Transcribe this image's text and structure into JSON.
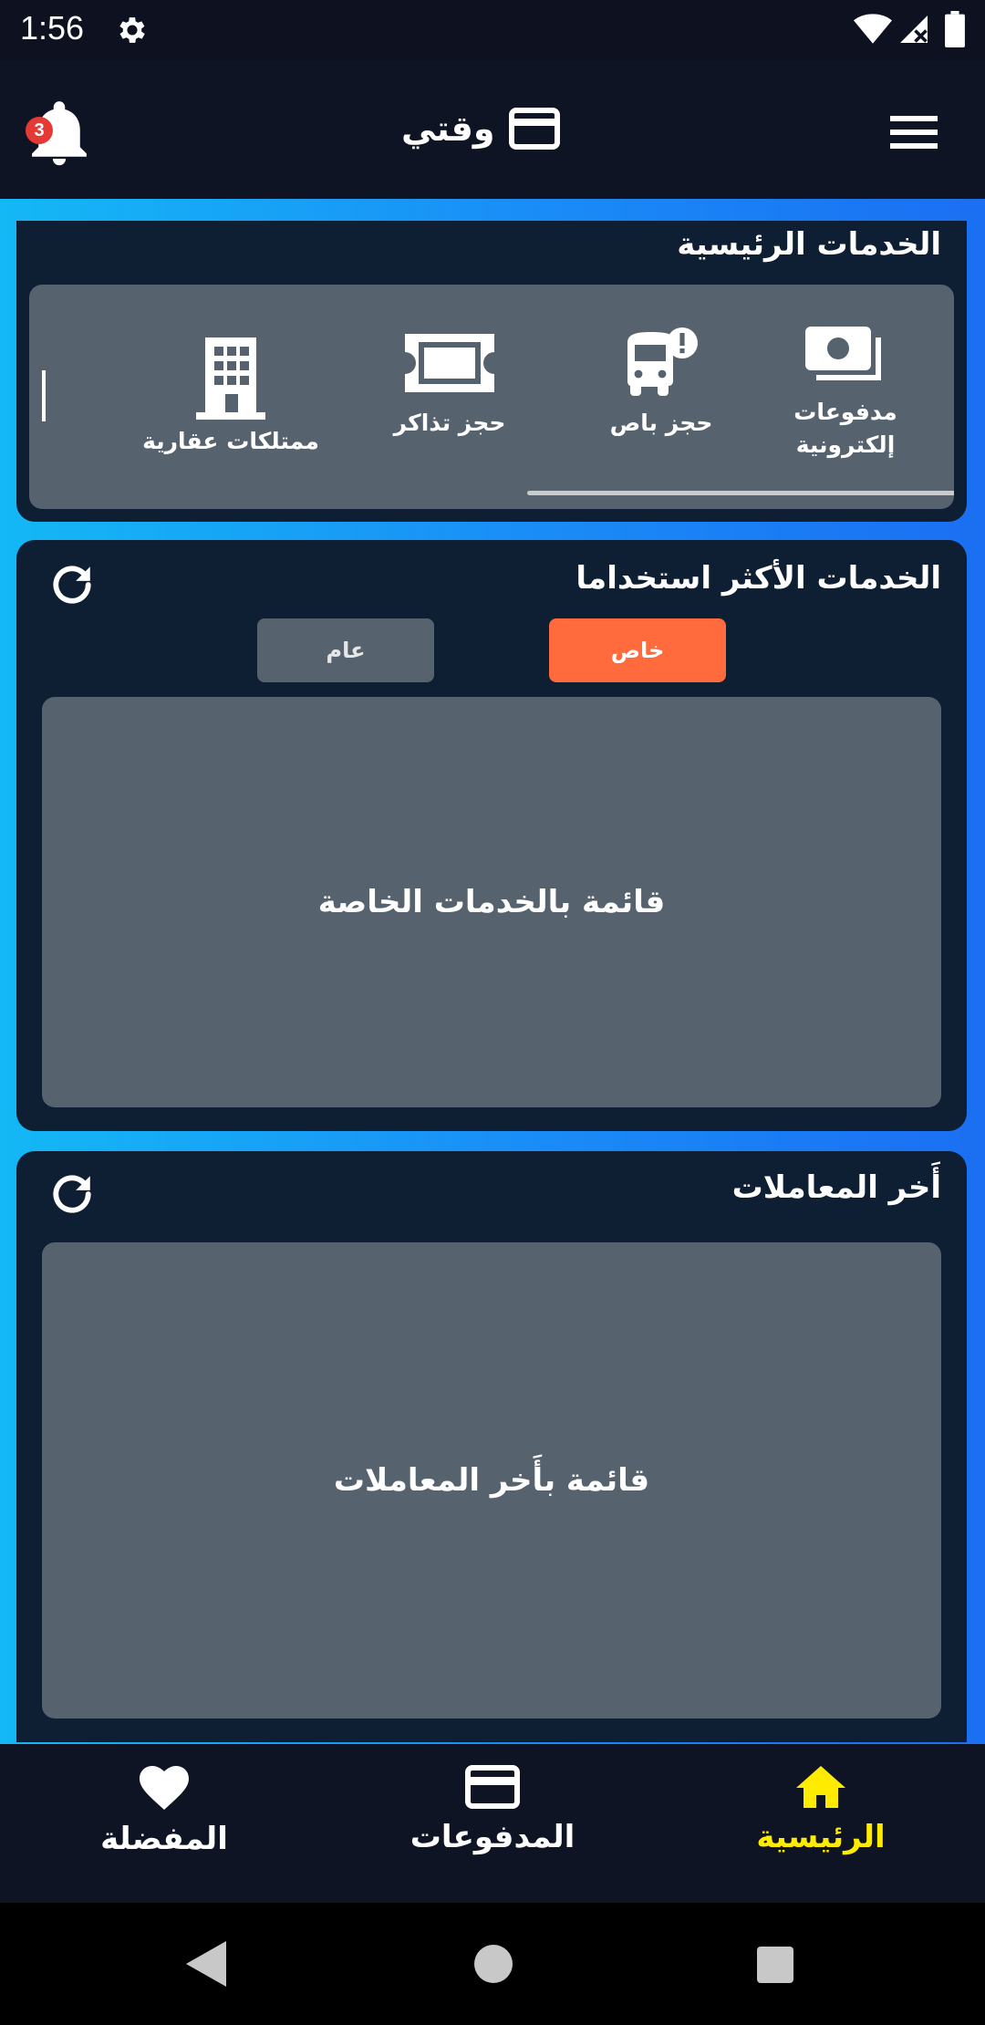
{
  "status_bar": {
    "time": "1:56"
  },
  "app_bar": {
    "title": "وقتي",
    "notification_count": "3"
  },
  "main_services": {
    "title": "الخدمات الرئيسية",
    "items": [
      {
        "label": "مدفوعات\nإلكترونية",
        "icon": "cash-icon"
      },
      {
        "label": "حجز باص",
        "icon": "bus-alert-icon"
      },
      {
        "label": "حجز تذاكر",
        "icon": "ticket-icon"
      },
      {
        "label": "ممتلكات عقارية",
        "icon": "building-icon"
      }
    ]
  },
  "most_used": {
    "title": "الخدمات الأكثر استخداما",
    "tabs": [
      {
        "label": "خاص",
        "active": true
      },
      {
        "label": "عام",
        "active": false
      }
    ],
    "list_placeholder": "قائمة بالخدمات الخاصة"
  },
  "recent_transactions": {
    "title": "أَخر المعاملات",
    "list_placeholder": "قائمة بأَخر المعاملات"
  },
  "bottom_nav": {
    "items": [
      {
        "label": "الرئيسية",
        "icon": "home-icon",
        "active": true
      },
      {
        "label": "المدفوعات",
        "icon": "credit-card-icon",
        "active": false
      },
      {
        "label": "المفضلة",
        "icon": "heart-icon",
        "active": false
      }
    ]
  },
  "colors": {
    "accent_orange": "#ff6b3d",
    "active_nav": "#ffeb00",
    "card_bg": "#0e1e33",
    "panel_gray": "#56626d",
    "badge_red": "#e53935"
  }
}
